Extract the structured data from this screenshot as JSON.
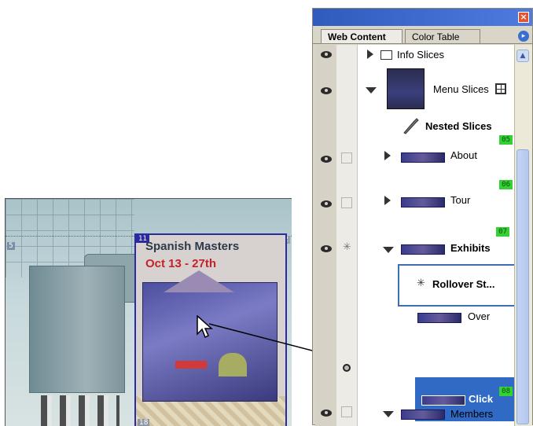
{
  "canvas": {
    "slice_title": "Spanish Masters",
    "slice_date": "Oct 13 - 27th",
    "slice_number": "11",
    "left_tag": "5",
    "right_tag": "12",
    "bottom_tag": "18"
  },
  "palette": {
    "close_label": "×",
    "tabs": [
      "Web Content",
      "Color Table"
    ],
    "menu_label": "▸",
    "items": [
      {
        "label": "Info Slices"
      },
      {
        "label": "Menu Slices"
      },
      {
        "label": "Nested Slices"
      },
      {
        "label": "About",
        "badge": "05"
      },
      {
        "label": "Tour",
        "badge": "06"
      },
      {
        "label": "Exhibits",
        "badge": "07"
      },
      {
        "label": "Rollover St..."
      },
      {
        "label": "Over"
      },
      {
        "label": "Click"
      },
      {
        "label": "Members",
        "badge": "08"
      }
    ]
  },
  "colors": {
    "selection_blue": "#316ac5",
    "slice_badge_green": "#33d133",
    "slice_border": "#2b2aa0",
    "date_red": "#c4222a"
  },
  "icons": [
    "eye-icon",
    "folder-icon",
    "grid-icon",
    "nested-slices-icon",
    "rollover-state-icon",
    "link-icon",
    "cursor-icon"
  ]
}
